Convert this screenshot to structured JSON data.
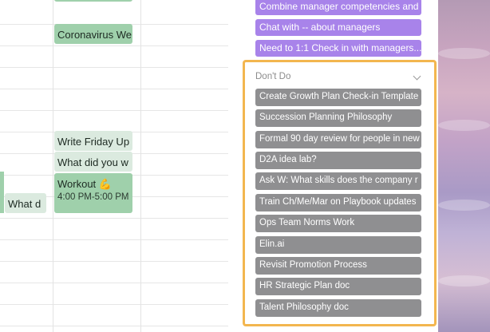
{
  "calendar": {
    "events": [
      {
        "title": "Coronavirus We",
        "time": ""
      },
      {
        "title": "Write Friday Up",
        "time": ""
      },
      {
        "title": "What did you w",
        "time": ""
      },
      {
        "title": "Workout 💪",
        "time": "4:00 PM-5:00 PM"
      },
      {
        "title": "What d",
        "time": ""
      }
    ]
  },
  "board": {
    "above_cards": [
      "Combine manager competencies and i",
      "Chat with -- about managers",
      "Need to 1:1 Check in with managers..."
    ],
    "dont_do": {
      "title": "Don't Do",
      "collapse_icon": "chevron-down-icon",
      "cards": [
        "Create Growth Plan Check-in Template",
        "Succession Planning Philosophy",
        "Formal 90 day review for people in new",
        "D2A idea lab?",
        "Ask W: What skills does the company r",
        "Train Ch/Me/Mar on Playbook updates",
        "Ops Team Norms Work",
        "Elin.ai",
        "Revisit Promotion Process",
        "HR Strategic Plan doc",
        "Talent Philosophy doc"
      ]
    }
  },
  "colors": {
    "event_green": "#9fd0ab",
    "event_pale": "#dbeadf",
    "purple_card": "#a883ea",
    "gray_card": "#8f8f91",
    "highlight_border": "#f3b64f"
  }
}
